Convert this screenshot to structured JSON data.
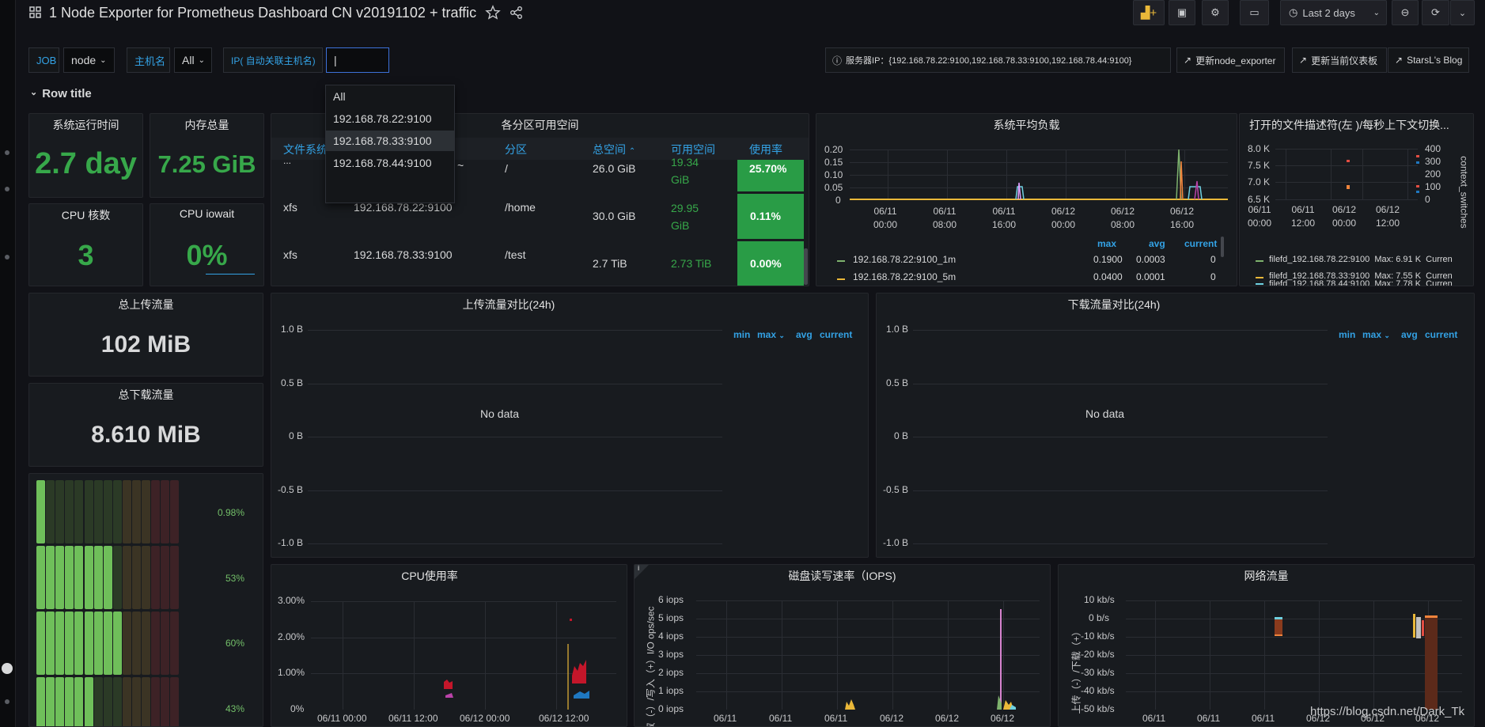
{
  "header": {
    "title": "1 Node Exporter for Prometheus Dashboard CN v20191102 + traffic",
    "time_picker": "Last 2 days"
  },
  "variables": {
    "job_label": "JOB",
    "job_value": "node",
    "host_label": "主机名",
    "host_value": "All",
    "ip_label": "IP( 自动关联主机名)",
    "ip_value": "|"
  },
  "links": {
    "server_ip": "服务器IP：{192.168.78.22:9100,192.168.78.33:9100,192.168.78.44:9100}",
    "update_exporter": "更新node_exporter",
    "update_dashboard": "更新当前仪表板",
    "blog": "StarsL's Blog"
  },
  "dropdown": {
    "items": [
      "All",
      "192.168.78.22:9100",
      "192.168.78.33:9100",
      "192.168.78.44:9100"
    ],
    "highlighted_index": 2
  },
  "row_title": "Row title",
  "stats": {
    "uptime": {
      "title": "系统运行时间",
      "value": "2.7 day"
    },
    "memory": {
      "title": "内存总量",
      "value": "7.25 GiB"
    },
    "cpu_cores": {
      "title": "CPU 核数",
      "value": "3"
    },
    "cpu_iowait": {
      "title": "CPU iowait",
      "value": "0%"
    },
    "upload_total": {
      "title": "总上传流量",
      "value": "102 MiB"
    },
    "download_total": {
      "title": "总下载流量",
      "value": "8.610 MiB"
    }
  },
  "disk_table": {
    "title": "各分区可用空间",
    "headers": [
      "文件系统",
      "分区",
      "总空间",
      "可用空间",
      "使用率"
    ],
    "rows": [
      {
        "fs": "...",
        "host": "~",
        "mount": "/",
        "total": "26.0 GiB",
        "free": "19.34 GiB",
        "usage": "25.70%"
      },
      {
        "fs": "xfs",
        "host": "192.168.78.22:9100",
        "mount": "/home",
        "total": "30.0 GiB",
        "free": "29.95 GiB",
        "usage": "0.11%"
      },
      {
        "fs": "xfs",
        "host": "192.168.78.33:9100",
        "mount": "/test",
        "total": "2.7 TiB",
        "free": "2.73 TiB",
        "usage": "0.00%"
      }
    ]
  },
  "load_panel": {
    "title": "系统平均负载",
    "y_ticks": [
      "0.20",
      "0.15",
      "0.10",
      "0.05",
      "0"
    ],
    "x_ticks": [
      "06/11\n00:00",
      "06/11\n08:00",
      "06/11\n16:00",
      "06/12\n00:00",
      "06/12\n08:00",
      "06/12\n16:00"
    ],
    "legend_cols": [
      "max",
      "avg",
      "current"
    ],
    "legend_rows": [
      {
        "name": "192.168.78.22:9100_1m",
        "max": "0.1900",
        "avg": "0.0003",
        "current": "0",
        "color": "#7eb26d"
      },
      {
        "name": "192.168.78.22:9100_5m",
        "max": "0.0400",
        "avg": "0.0001",
        "current": "0",
        "color": "#eab839"
      }
    ]
  },
  "fd_panel": {
    "title": "打开的文件描述符(左 )/每秒上下文切换...",
    "y_left": [
      "8.0 K",
      "7.5 K",
      "7.0 K",
      "6.5 K"
    ],
    "y_right": [
      "400",
      "300",
      "200",
      "100",
      "0"
    ],
    "right_label": "context_switches",
    "x_ticks": [
      "06/11\n00:00",
      "06/11\n12:00",
      "06/12\n00:00",
      "06/12\n12:00"
    ],
    "legend_rows": [
      {
        "text": "filefd_192.168.78.22:9100  Max: 6.91 K  Curren",
        "color": "#7eb26d"
      },
      {
        "text": "filefd_192.168.78.33:9100  Max: 7.55 K  Curren",
        "color": "#eab839"
      },
      {
        "text": "filefd_192.168.78.44:9100  Max: 7.78 K  Curren",
        "color": "#6ed0e0"
      }
    ]
  },
  "upload_cmp": {
    "title": "上传流量对比(24h)",
    "y_ticks": [
      "1.0 B",
      "0.5 B",
      "0 B",
      "-0.5 B",
      "-1.0 B"
    ],
    "no_data": "No data",
    "legend": [
      "min",
      "max",
      "avg",
      "current"
    ]
  },
  "download_cmp": {
    "title": "下载流量对比(24h)",
    "y_ticks": [
      "1.0 B",
      "0.5 B",
      "0 B",
      "-0.5 B",
      "-1.0 B"
    ],
    "no_data": "No data",
    "legend": [
      "min",
      "max",
      "avg",
      "current"
    ]
  },
  "bar_gauge": {
    "labels": [
      "0.98%",
      "53%",
      "60%",
      "43%"
    ],
    "fractions": [
      0.02,
      0.53,
      0.6,
      0.43
    ]
  },
  "cpu_panel": {
    "title": "CPU使用率",
    "y_ticks": [
      "3.00%",
      "2.00%",
      "1.00%",
      "0%"
    ],
    "x_ticks": [
      "06/11 00:00",
      "06/11 12:00",
      "06/12 00:00",
      "06/12 12:00"
    ]
  },
  "iops_panel": {
    "title": "磁盘读写速率（IOPS)",
    "y_ticks": [
      "6 iops",
      "5 iops",
      "4 iops",
      "3 iops",
      "2 iops",
      "1 iops",
      "0 iops"
    ],
    "y_label": "读取（-）/写入（+）I/O ops/sec",
    "x_ticks": [
      "06/11",
      "06/11",
      "06/11",
      "06/12",
      "06/12",
      "06/12"
    ]
  },
  "net_panel": {
    "title": "网络流量",
    "y_ticks": [
      "10 kb/s",
      "0 b/s",
      "-10 kb/s",
      "-20 kb/s",
      "-30 kb/s",
      "-40 kb/s",
      "-50 kb/s"
    ],
    "y_label": "上传（-）/下载（+）",
    "x_ticks": [
      "06/11",
      "06/11",
      "06/11",
      "06/12",
      "06/12",
      "06/12"
    ]
  },
  "watermark": "https://blog.csdn.net/Dark_Tk",
  "colors": {
    "accent": "#33a2e5",
    "ok": "#37a84a",
    "bg": "#111217",
    "panel": "#181b1f"
  }
}
